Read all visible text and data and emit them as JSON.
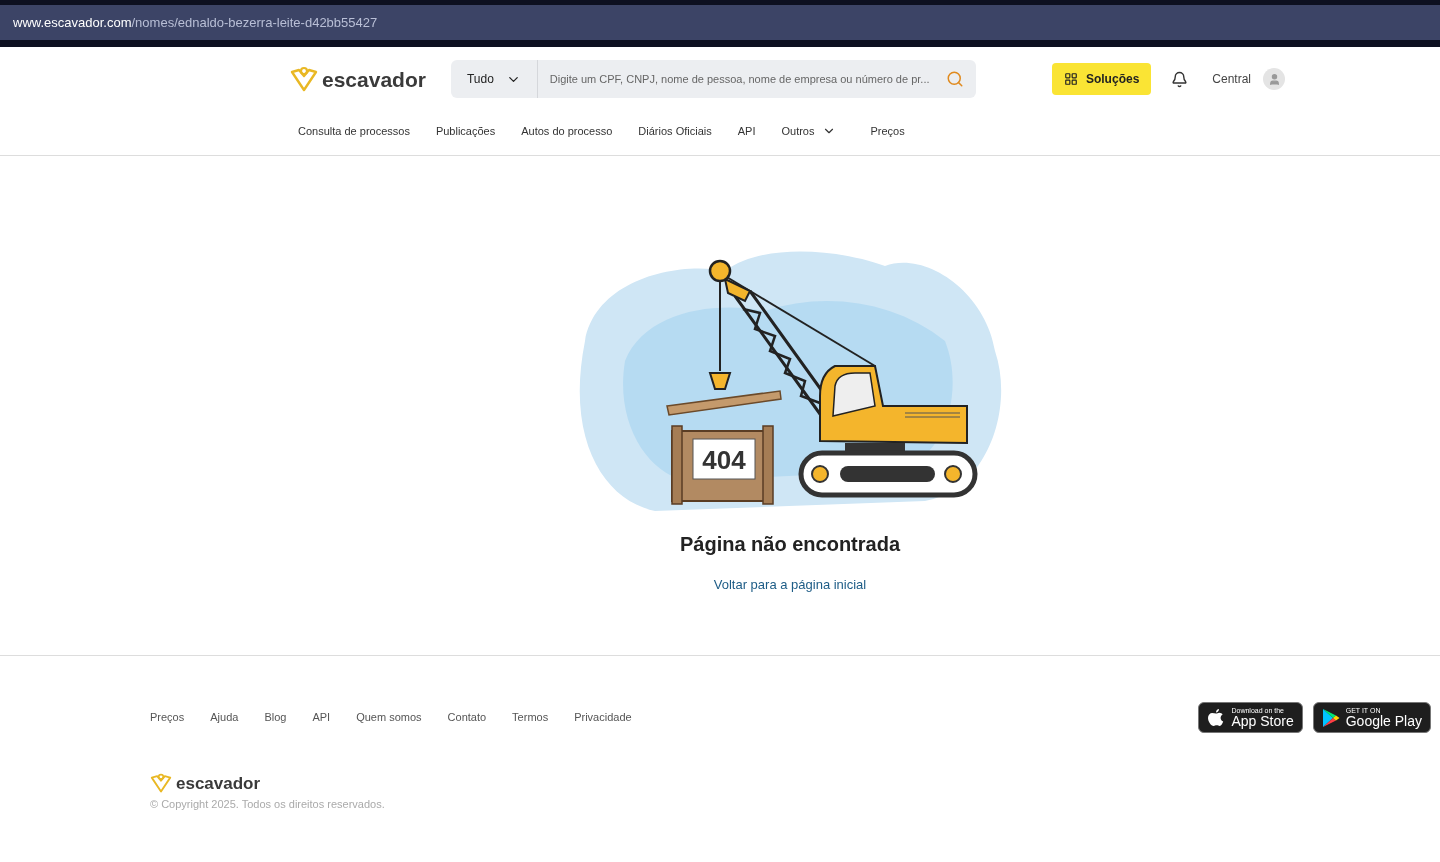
{
  "address_bar": {
    "url": "**www.escavador.com**/nomes/ednaldo-bezerra-leite-d42bb55427"
  },
  "header": {
    "logo": "escavador",
    "search": {
      "scope": "Tudo",
      "placeholder": "Digite um CPF, CNPJ, nome de pessoa, nome de empresa ou número de pr..."
    },
    "solutions_button": "Soluções",
    "account": "Central"
  },
  "nav": [
    {
      "label": "Consulta de processos",
      "kind": "link"
    },
    {
      "label": "Publicações",
      "kind": "link"
    },
    {
      "label": "Autos do processo",
      "kind": "link"
    },
    {
      "label": "Diários Oficiais",
      "kind": "link"
    },
    {
      "label": "API",
      "kind": "link"
    },
    {
      "label": "Outros",
      "kind": "dropdown"
    },
    {
      "label": "Preços",
      "kind": "link"
    }
  ],
  "error": {
    "code": "404",
    "title": "Página não encontrada",
    "link": "Voltar para a página inicial"
  },
  "footer": {
    "links": [
      "Preços",
      "Ajuda",
      "Blog",
      "API",
      "Quem somos",
      "Contato",
      "Termos",
      "Privacidade"
    ],
    "logo": "escavador",
    "copyright": "© Copyright 2025. Todos os direitos reservados.",
    "badges": [
      {
        "kind": "apple",
        "small": "Download on the",
        "big": "App Store"
      },
      {
        "kind": "google",
        "small": "GET IT ON",
        "big": "Google Play"
      }
    ]
  }
}
